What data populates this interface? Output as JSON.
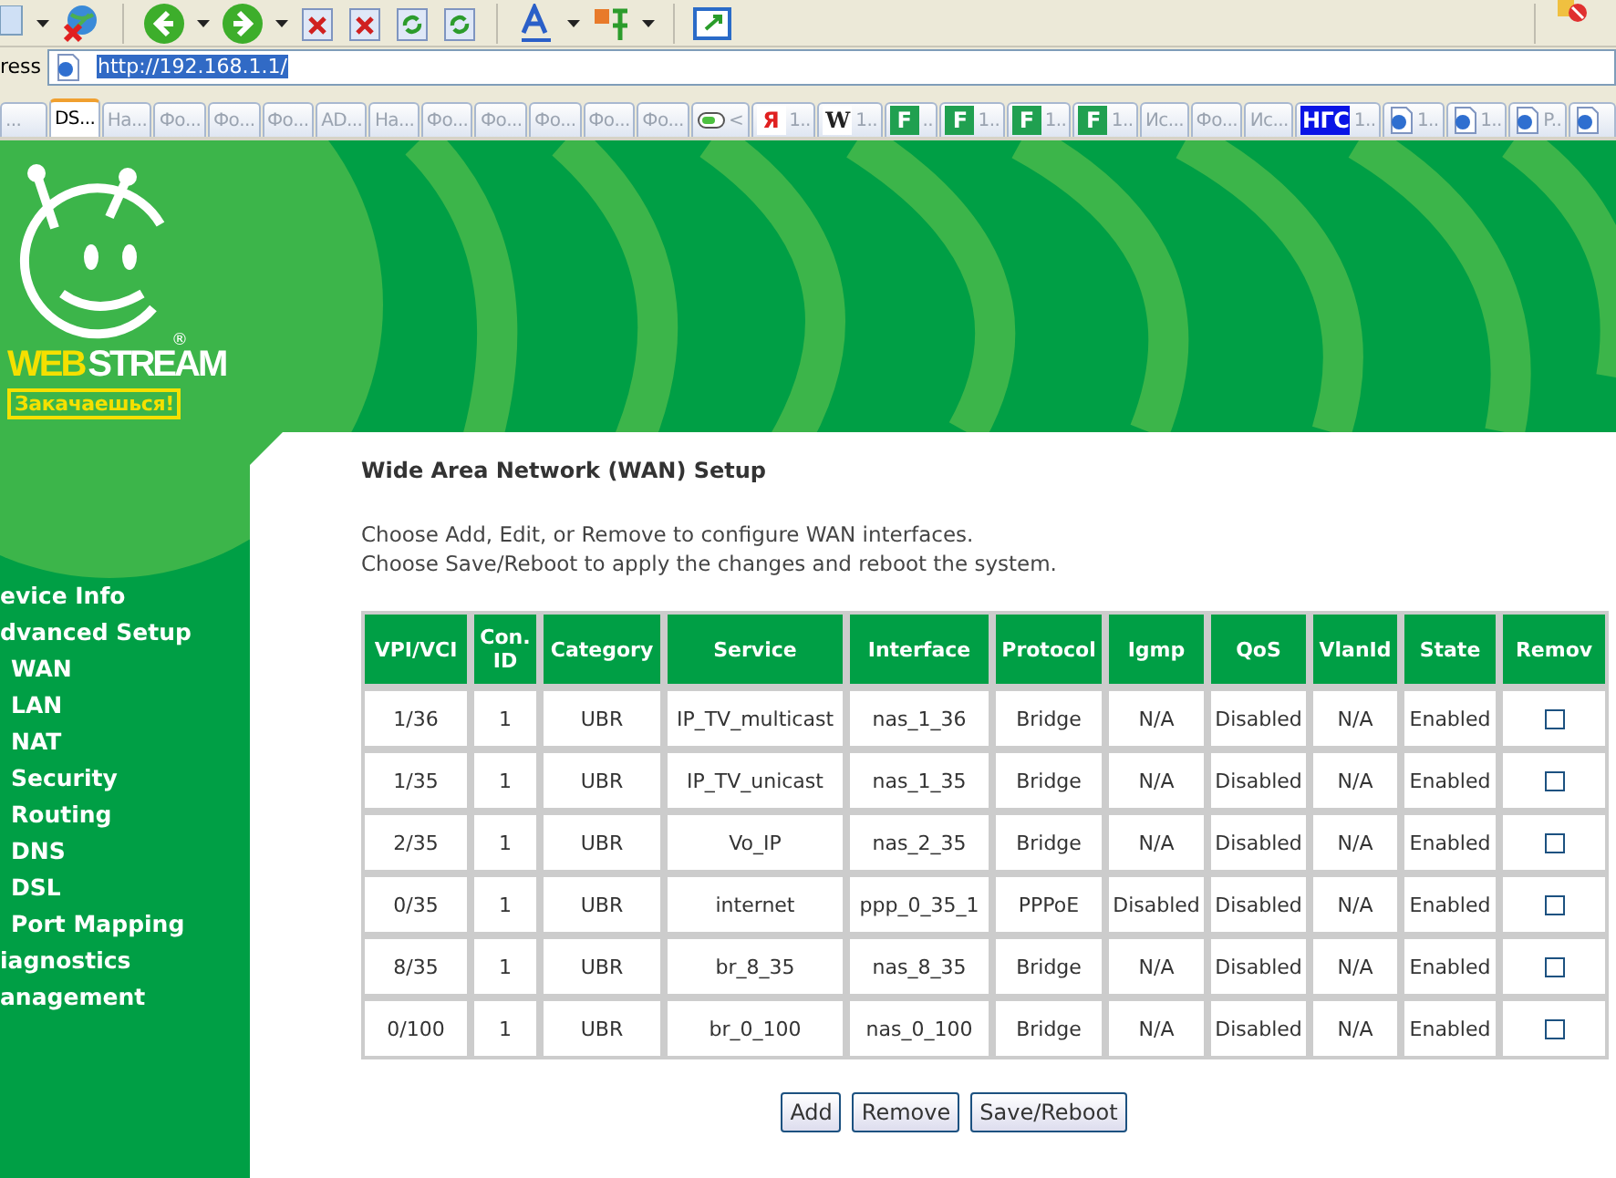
{
  "address_bar": {
    "label": "ress",
    "url": "http://192.168.1.1/",
    "selected": true
  },
  "tabs": [
    {
      "label": "...",
      "selected": false
    },
    {
      "label": "DS...",
      "selected": true
    },
    {
      "label": "На...",
      "selected": false
    },
    {
      "label": "Фо...",
      "selected": false
    },
    {
      "label": "Фо...",
      "selected": false
    },
    {
      "label": "Фо...",
      "selected": false
    },
    {
      "label": "AD...",
      "selected": false
    },
    {
      "label": "На...",
      "selected": false
    },
    {
      "label": "Фо...",
      "selected": false
    },
    {
      "label": "Фо...",
      "selected": false
    },
    {
      "label": "Фо...",
      "selected": false
    },
    {
      "label": "Фо...",
      "selected": false
    },
    {
      "label": "Фо...",
      "selected": false
    },
    {
      "kind": "toggle",
      "label": "<",
      "selected": false
    },
    {
      "kind": "letter",
      "icon_text": "Я",
      "color": "#e02020",
      "label": "1..",
      "selected": false
    },
    {
      "kind": "letter",
      "icon_text": "W",
      "color": "#ffffff",
      "label": "1..",
      "selected": false
    },
    {
      "kind": "letter",
      "icon_text": "F",
      "color": "#20a050",
      "label": "..",
      "selected": false
    },
    {
      "kind": "letter",
      "icon_text": "F",
      "color": "#20a050",
      "label": "1..",
      "selected": false
    },
    {
      "kind": "letter",
      "icon_text": "F",
      "color": "#20a050",
      "label": "1..",
      "selected": false
    },
    {
      "kind": "letter",
      "icon_text": "F",
      "color": "#20a050",
      "label": "1..",
      "selected": false
    },
    {
      "label": "Ис...",
      "selected": false
    },
    {
      "label": "Фо...",
      "selected": false
    },
    {
      "label": "Ис...",
      "selected": false
    },
    {
      "kind": "letter",
      "icon_text": "НГС",
      "color": "#0a14e6",
      "label": "1..",
      "selected": false
    },
    {
      "kind": "page",
      "label": "1..",
      "selected": false
    },
    {
      "kind": "page",
      "label": "1..",
      "selected": false
    },
    {
      "kind": "page",
      "label": "P..",
      "selected": false
    },
    {
      "kind": "page",
      "selected": false
    }
  ],
  "logo": {
    "word_1": "WEB",
    "word_2": "STREAM",
    "registered": "®",
    "slogan": "Закачаешься!"
  },
  "sidebar": {
    "items": [
      {
        "label": "evice Info"
      },
      {
        "label": "dvanced Setup",
        "children": [
          {
            "label": "WAN"
          },
          {
            "label": "LAN"
          },
          {
            "label": "NAT"
          },
          {
            "label": "Security"
          },
          {
            "label": "Routing"
          },
          {
            "label": "DNS"
          },
          {
            "label": "DSL"
          },
          {
            "label": "Port Mapping"
          }
        ]
      },
      {
        "label": "iagnostics"
      },
      {
        "label": "anagement"
      }
    ]
  },
  "content": {
    "title": "Wide Area Network (WAN) Setup",
    "instructions": [
      "Choose Add, Edit, or Remove to configure WAN interfaces.",
      "Choose Save/Reboot to apply the changes and reboot the system."
    ],
    "table": {
      "columns": [
        "VPI/VCI",
        "Con. ID",
        "Category",
        "Service",
        "Interface",
        "Protocol",
        "Igmp",
        "QoS",
        "VlanId",
        "State",
        "Remov"
      ],
      "rows": [
        {
          "cells": [
            "1/36",
            "1",
            "UBR",
            "IP_TV_multicast",
            "nas_1_36",
            "Bridge",
            "N/A",
            "Disabled",
            "N/A",
            "Enabled"
          ],
          "remove_checked": false
        },
        {
          "cells": [
            "1/35",
            "1",
            "UBR",
            "IP_TV_unicast",
            "nas_1_35",
            "Bridge",
            "N/A",
            "Disabled",
            "N/A",
            "Enabled"
          ],
          "remove_checked": false
        },
        {
          "cells": [
            "2/35",
            "1",
            "UBR",
            "Vo_IP",
            "nas_2_35",
            "Bridge",
            "N/A",
            "Disabled",
            "N/A",
            "Enabled"
          ],
          "remove_checked": false
        },
        {
          "cells": [
            "0/35",
            "1",
            "UBR",
            "internet",
            "ppp_0_35_1",
            "PPPoE",
            "Disabled",
            "Disabled",
            "N/A",
            "Enabled"
          ],
          "remove_checked": false
        },
        {
          "cells": [
            "8/35",
            "1",
            "UBR",
            "br_8_35",
            "nas_8_35",
            "Bridge",
            "N/A",
            "Disabled",
            "N/A",
            "Enabled"
          ],
          "remove_checked": false
        },
        {
          "cells": [
            "0/100",
            "1",
            "UBR",
            "br_0_100",
            "nas_0_100",
            "Bridge",
            "N/A",
            "Disabled",
            "N/A",
            "Enabled"
          ],
          "remove_checked": false
        }
      ]
    },
    "buttons": [
      "Add",
      "Remove",
      "Save/Reboot"
    ]
  }
}
